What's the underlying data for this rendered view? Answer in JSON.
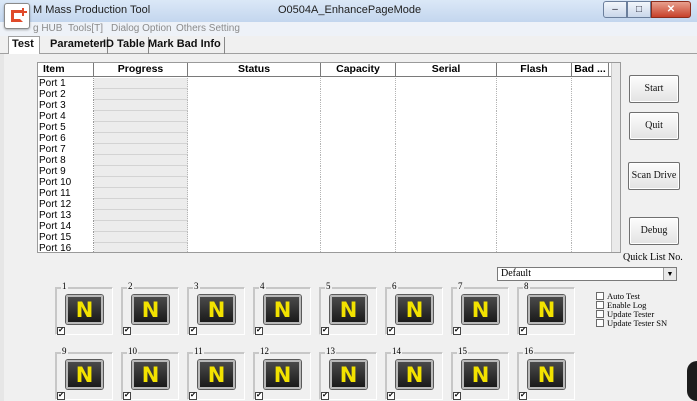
{
  "window": {
    "title_left": "M Mass Production Tool",
    "title_center": "O0504A_EnhancePageMode",
    "minimize": "–",
    "maximize": "□",
    "close": "✕"
  },
  "menu": [
    "g HUB",
    "Tools[T]",
    "Dialog Option",
    "Others Setting"
  ],
  "tabs": [
    "Test",
    "Parameter",
    "ID Table",
    "Mark Bad Info"
  ],
  "table": {
    "columns": [
      "Item",
      "Progress",
      "Status",
      "Capacity",
      "Serial",
      "Flash",
      "Bad ..."
    ],
    "rows": [
      "Port 1",
      "Port 2",
      "Port 3",
      "Port 4",
      "Port 5",
      "Port 6",
      "Port 7",
      "Port 8",
      "Port 9",
      "Port 10",
      "Port 11",
      "Port 12",
      "Port 13",
      "Port 14",
      "Port 15",
      "Port 16"
    ]
  },
  "buttons": {
    "start": "Start",
    "quit": "Quit",
    "scan_drive": "Scan Drive",
    "debug": "Debug"
  },
  "quick_list": {
    "label": "Quick List No.",
    "value": "Default"
  },
  "options": [
    "Auto Test",
    "Enable Log",
    "Update Tester",
    "Update Tester SN"
  ],
  "ports": {
    "letter": "N",
    "row1": [
      "1",
      "2",
      "3",
      "4",
      "5",
      "6",
      "7",
      "8"
    ],
    "row2": [
      "9",
      "10",
      "11",
      "12",
      "13",
      "14",
      "15",
      "16"
    ],
    "check_mark": "✔"
  }
}
